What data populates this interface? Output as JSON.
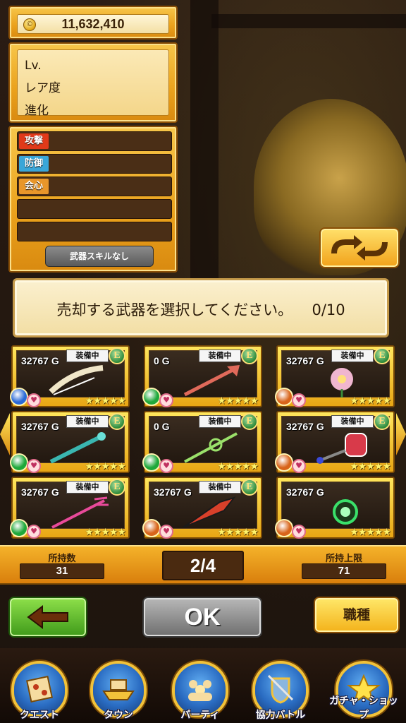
{
  "money": "11,632,410",
  "info": {
    "level_label": "Lv.",
    "rarity_label": "レア度",
    "evolution_label": "進化"
  },
  "stats": {
    "attack": "攻撃",
    "defense": "防御",
    "critical": "会心"
  },
  "skill_button": "武器スキルなし",
  "sort_icon": "sort-arrows-icon",
  "banner": {
    "message": "売却する武器を選択してください。",
    "count": "0/10"
  },
  "weapons": [
    {
      "price": "32767 G",
      "equip": "装備中",
      "e": "E",
      "type_icon": "blue-type-icon",
      "stars": "★★★★★",
      "art": "bow",
      "art_color": "#f0e6c8"
    },
    {
      "price": "0 G",
      "equip": "装備中",
      "e": "E",
      "type_icon": "green-type-icon",
      "stars": "★★★★★",
      "art": "spear",
      "art_color": "#e06a5a"
    },
    {
      "price": "32767 G",
      "equip": "装備中",
      "e": "E",
      "type_icon": "orange-type-icon",
      "stars": "★★★★★",
      "art": "flower",
      "art_color": "#f0b6d0"
    },
    {
      "price": "32767 G",
      "equip": "装備中",
      "e": "E",
      "type_icon": "green-type-icon",
      "stars": "★★★★★",
      "art": "staff",
      "art_color": "#3ab6b0"
    },
    {
      "price": "0 G",
      "equip": "装備中",
      "e": "E",
      "type_icon": "green-type-icon",
      "stars": "★★★★★",
      "art": "wand",
      "art_color": "#9ae06a"
    },
    {
      "price": "32767 G",
      "equip": "装備中",
      "e": "E",
      "type_icon": "orange-type-icon",
      "stars": "★★★★★",
      "art": "lantern",
      "art_color": "#d83a4a"
    },
    {
      "price": "32767 G",
      "equip": "装備中",
      "e": "E",
      "type_icon": "green-type-icon",
      "stars": "★★★★★",
      "art": "trident",
      "art_color": "#e84a9a"
    },
    {
      "price": "32767 G",
      "equip": "装備中",
      "e": "E",
      "type_icon": "orange-type-icon",
      "stars": "★★★★★",
      "art": "blade",
      "art_color": "#d8402a"
    },
    {
      "price": "32767 G",
      "equip": "",
      "e": "",
      "type_icon": "orange-type-icon",
      "stars": "★★★★★",
      "art": "orb",
      "art_color": "#3ae06a"
    }
  ],
  "counts": {
    "owned_label": "所持数",
    "owned": "31",
    "page": "2/4",
    "limit_label": "所持上限",
    "limit": "71"
  },
  "buttons": {
    "back_icon": "back-arrow-icon",
    "ok": "OK",
    "job": "職種"
  },
  "nav": [
    {
      "label": "クエスト",
      "icon": "quest-map-icon"
    },
    {
      "label": "タウン",
      "icon": "town-ship-icon"
    },
    {
      "label": "パーティ",
      "icon": "party-icon"
    },
    {
      "label": "協力バトル",
      "icon": "coop-battle-icon"
    },
    {
      "label": "ガチャ・ショップ",
      "icon": "gacha-star-icon"
    }
  ],
  "colors": {
    "gold": "#f2b22a",
    "attack": "#e03a1a",
    "defense": "#3aa6d8",
    "critical": "#e8962a",
    "blue_type": "#2a6ad8",
    "green_type": "#1ea83a",
    "orange_type": "#d8641a"
  }
}
